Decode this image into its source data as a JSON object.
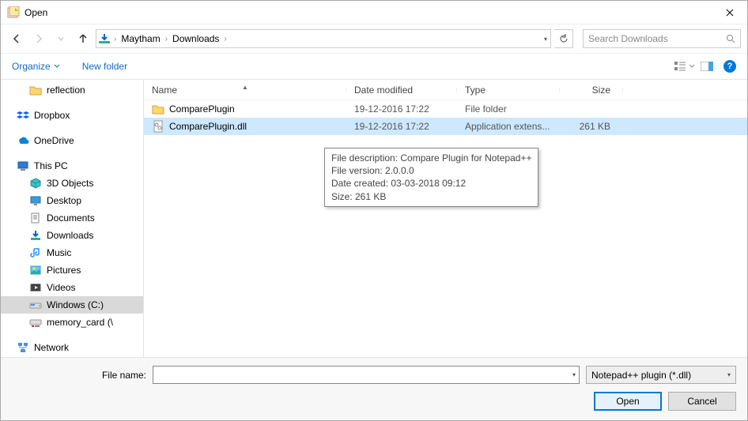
{
  "window": {
    "title": "Open"
  },
  "nav": {
    "breadcrumb": [
      "Maytham",
      "Downloads"
    ],
    "search_placeholder": "Search Downloads"
  },
  "toolbar": {
    "organize": "Organize",
    "new_folder": "New folder"
  },
  "tree": {
    "quick": [
      {
        "label": "reflection",
        "icon": "folder"
      }
    ],
    "cloud": [
      {
        "label": "Dropbox",
        "icon": "dropbox"
      },
      {
        "label": "OneDrive",
        "icon": "onedrive"
      }
    ],
    "this_pc_label": "This PC",
    "this_pc": [
      {
        "label": "3D Objects",
        "icon": "3d"
      },
      {
        "label": "Desktop",
        "icon": "desktop"
      },
      {
        "label": "Documents",
        "icon": "documents"
      },
      {
        "label": "Downloads",
        "icon": "downloads"
      },
      {
        "label": "Music",
        "icon": "music"
      },
      {
        "label": "Pictures",
        "icon": "pictures"
      },
      {
        "label": "Videos",
        "icon": "videos"
      },
      {
        "label": "Windows (C:)",
        "icon": "drive",
        "selected": true
      },
      {
        "label": "memory_card (\\",
        "icon": "netdrive"
      }
    ],
    "network_label": "Network"
  },
  "columns": {
    "name": "Name",
    "date": "Date modified",
    "type": "Type",
    "size": "Size"
  },
  "files": [
    {
      "name": "ComparePlugin",
      "date": "19-12-2016 17:22",
      "type": "File folder",
      "size": "",
      "icon": "folder",
      "selected": false
    },
    {
      "name": "ComparePlugin.dll",
      "date": "19-12-2016 17:22",
      "type": "Application extens...",
      "size": "261 KB",
      "icon": "dll",
      "selected": true
    }
  ],
  "tooltip": {
    "l1": "File description: Compare Plugin for Notepad++",
    "l2": "File version: 2.0.0.0",
    "l3": "Date created: 03-03-2018 09:12",
    "l4": "Size: 261 KB"
  },
  "footer": {
    "filename_label": "File name:",
    "filename_value": "",
    "filter": "Notepad++ plugin (*.dll)",
    "open": "Open",
    "cancel": "Cancel"
  }
}
